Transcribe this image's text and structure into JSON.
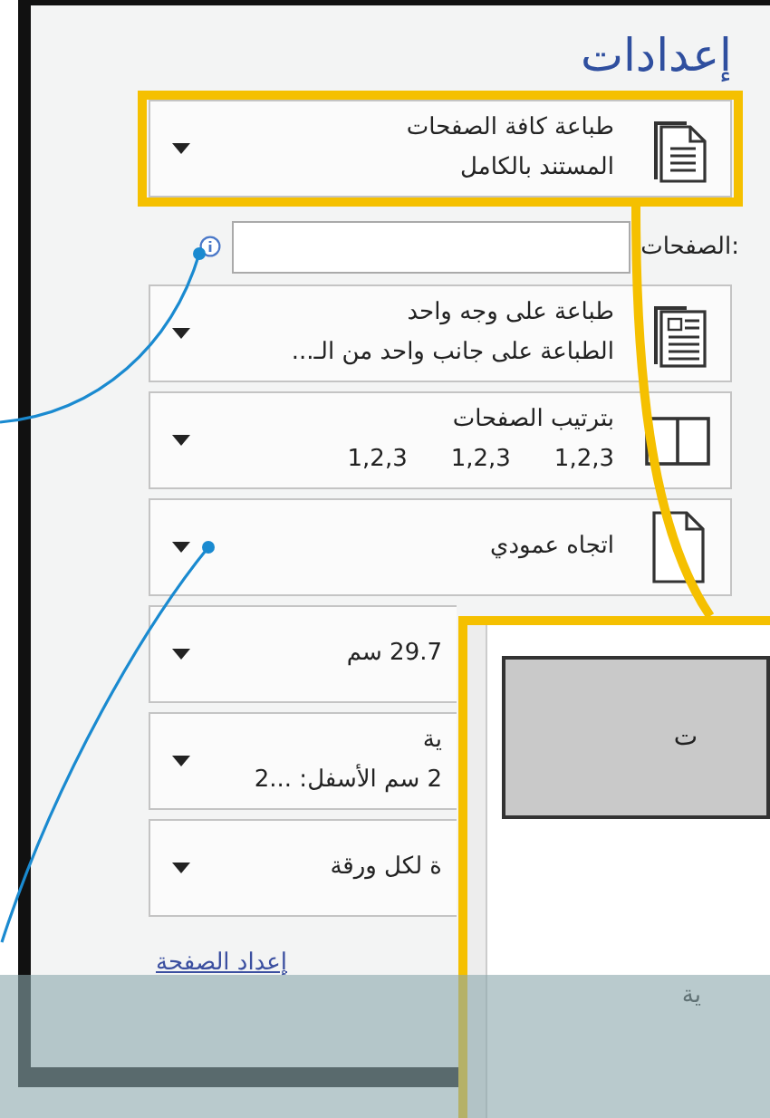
{
  "title": "إعدادات",
  "settings": [
    {
      "kind": "document",
      "highlighted": true,
      "lines": [
        "طباعة كافة الصفحات",
        "المستند بالكامل"
      ]
    },
    {
      "kind": "field",
      "label": "الصفحات:"
    },
    {
      "kind": "one-sided",
      "highlighted": false,
      "lines": [
        "طباعة على وجه واحد",
        "الطباعة على جانب واحد من الـ..."
      ]
    },
    {
      "kind": "collated",
      "highlighted": false,
      "lines": [
        "بترتيب الصفحات"
      ],
      "sequences": [
        "1,2,3",
        "1,2,3",
        "1,2,3"
      ]
    },
    {
      "kind": "portrait",
      "highlighted": false,
      "lines": [
        "اتجاه عمودي"
      ]
    },
    {
      "kind": "cut",
      "highlighted": false,
      "lines": [
        "29.7 سم"
      ]
    },
    {
      "kind": "cut",
      "highlighted": false,
      "lines": [
        "ية",
        "2 سم الأسفل: ...2"
      ]
    },
    {
      "kind": "cut",
      "highlighted": false,
      "lines": [
        "ة لكل ورقة"
      ]
    }
  ],
  "page_setup_link": "إعداد الصفحة",
  "popup": {
    "button": "ت",
    "label": "ية"
  }
}
